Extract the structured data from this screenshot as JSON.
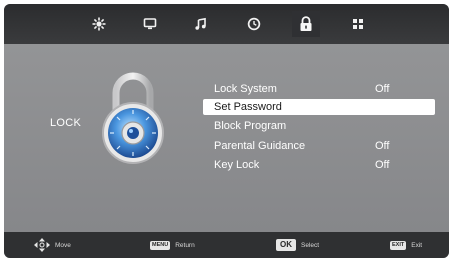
{
  "colors": {
    "topbar": "#2b2c2e",
    "panel": "#8a8b8d",
    "highlight": "#ffffff",
    "text": "#ffffff",
    "bottombar": "#2f3032",
    "padlock_blue": "#3f86d6"
  },
  "tabs": [
    {
      "icon": "picture-icon",
      "active": false
    },
    {
      "icon": "sound-icon",
      "active": false
    },
    {
      "icon": "music-icon",
      "active": false
    },
    {
      "icon": "clock-icon",
      "active": false
    },
    {
      "icon": "lock-icon",
      "active": true
    },
    {
      "icon": "apps-icon",
      "active": false
    }
  ],
  "section": {
    "title": "LOCK",
    "illustration": "padlock-icon"
  },
  "menu": {
    "selected_index": 1,
    "items": [
      {
        "label": "Lock System",
        "value": "Off"
      },
      {
        "label": "Set Password",
        "value": ""
      },
      {
        "label": "Block Program",
        "value": ""
      },
      {
        "label": "Parental Guidance",
        "value": "Off"
      },
      {
        "label": "Key Lock",
        "value": "Off"
      }
    ]
  },
  "footer": {
    "move": {
      "icon": "dpad-icon",
      "label": "Move"
    },
    "return": {
      "key": "MENU",
      "label": "Return"
    },
    "select": {
      "key": "OK",
      "label": "Select"
    },
    "exit": {
      "key": "EXIT",
      "label": "Exit"
    }
  }
}
